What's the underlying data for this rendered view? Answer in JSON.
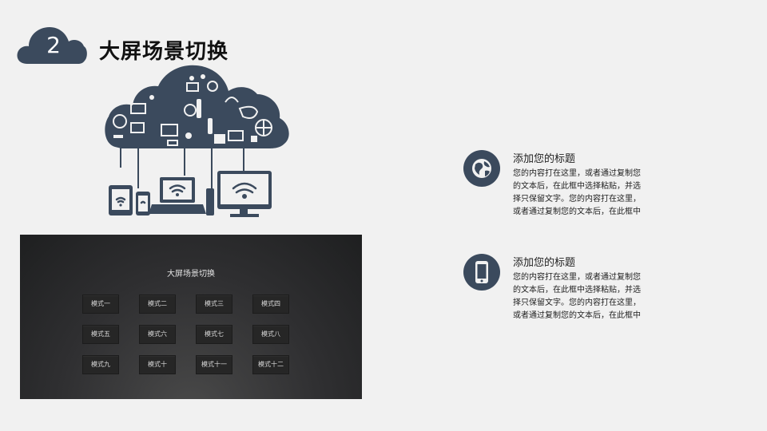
{
  "header": {
    "section_number": "2",
    "title": "大屏场景切换"
  },
  "screen_panel": {
    "title": "大屏场景切换",
    "modes": [
      "模式一",
      "模式二",
      "模式三",
      "模式四",
      "模式五",
      "模式六",
      "模式七",
      "模式八",
      "模式九",
      "模式十",
      "模式十一",
      "模式十二"
    ]
  },
  "features": [
    {
      "icon": "globe-icon",
      "title": "添加您的标题",
      "body": "您的内容打在这里，或者通过复制您的文本后，在此框中选择粘贴，并选择只保留文字。您的内容打在这里，或者通过复制您的文本后，在此框中"
    },
    {
      "icon": "smartphone-icon",
      "title": "添加您的标题",
      "body": "您的内容打在这里，或者通过复制您的文本后，在此框中选择粘贴，并选择只保留文字。您的内容打在这里，或者通过复制您的文本后，在此框中"
    }
  ],
  "colors": {
    "accent": "#3b4a5d",
    "panel_bg": "#2a2b2c",
    "page_bg": "#f1f1f1"
  }
}
